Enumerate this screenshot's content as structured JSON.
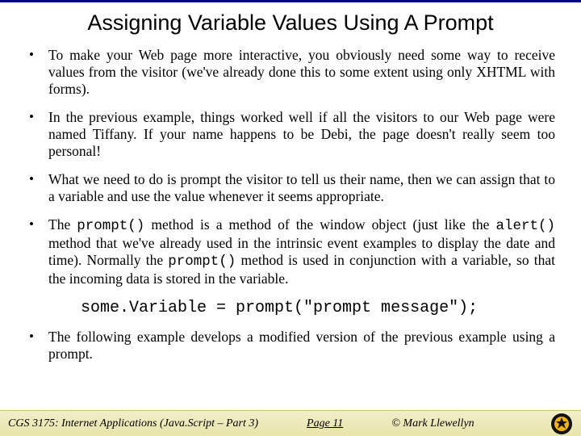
{
  "title": "Assigning Variable Values Using A Prompt",
  "bullets": {
    "b1": "To make your Web page more interactive, you obviously need some way to receive values from the visitor (we've already done this to some extent using only XHTML with forms).",
    "b2": "In the previous example, things worked well if all the visitors to our Web page were named Tiffany.  If your name happens to be Debi, the page doesn't really seem too personal!",
    "b3": "What we need to do is prompt the visitor to tell us their name, then we can assign that to a variable and use the value whenever it seems appropriate.",
    "b4_pre": "The ",
    "b4_code1": "prompt()",
    "b4_mid1": " method is a method of the window object (just like the ",
    "b4_code2": "alert()",
    "b4_mid2": " method that we've already used in the intrinsic event examples to display the date and time).  Normally the ",
    "b4_code3": "prompt()",
    "b4_post": " method is used in conjunction with a variable, so that the incoming data is stored in the variable.",
    "b5": "The following example develops a modified version of the previous example using a prompt."
  },
  "codeline": "some.Variable = prompt(\"prompt message\");",
  "footer": {
    "course": "CGS 3175: Internet Applications (Java.Script – Part 3)",
    "page": "Page 11",
    "author": "© Mark Llewellyn"
  }
}
